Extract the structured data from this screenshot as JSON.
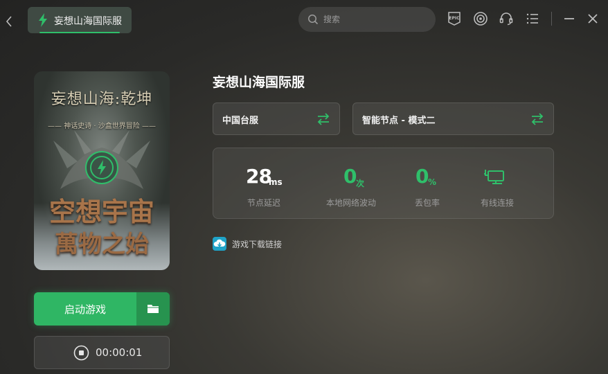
{
  "titlebar": {
    "back_icon": "chevron-left-icon",
    "tab_label": "妄想山海国际服",
    "tab_icon": "lightning-bolt-icon",
    "search_placeholder": "搜索",
    "icons": [
      "epic-games-icon",
      "steam-icon",
      "headset-support-icon",
      "menu-list-icon",
      "minimize-icon",
      "close-icon"
    ]
  },
  "cover": {
    "title": "妄想山海:乾坤",
    "subtitle": "—— 神话史诗 · 沙盒世界冒险 ——",
    "slogan_line1": "空想宇宙",
    "slogan_line2": "萬物之始"
  },
  "left": {
    "launch_label": "启动游戏",
    "timer": "00:00:01"
  },
  "main": {
    "game_title": "妄想山海国际服",
    "server_label": "中国台服",
    "node_label": "智能节点 - 模式二",
    "stats": [
      {
        "value": "28",
        "unit": "ms",
        "label": "节点延迟",
        "color": "#ffffff"
      },
      {
        "value": "0",
        "unit": "次",
        "label": "本地网络波动",
        "color": "#2fbf6a"
      },
      {
        "value": "0",
        "unit": "%",
        "label": "丢包率",
        "color": "#2fbf6a"
      },
      {
        "label": "有线连接",
        "icon": "wired-connection-icon",
        "color": "#2fbf6a"
      }
    ],
    "download_label": "游戏下载链接"
  },
  "colors": {
    "accent": "#2fbf6a",
    "launch_button": "#2fb664",
    "download_icon": "#1fa3c8"
  }
}
